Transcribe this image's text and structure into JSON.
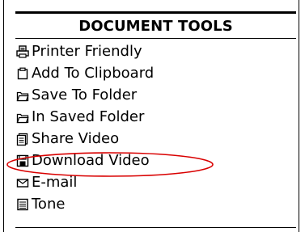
{
  "panel": {
    "title": "DOCUMENT TOOLS",
    "items": [
      {
        "icon": "printer-icon",
        "label": "Printer Friendly"
      },
      {
        "icon": "clipboard-icon",
        "label": "Add To Clipboard"
      },
      {
        "icon": "folder-save-icon",
        "label": "Save To Folder"
      },
      {
        "icon": "folder-open-icon",
        "label": "In Saved Folder"
      },
      {
        "icon": "share-video-icon",
        "label": "Share Video"
      },
      {
        "icon": "floppy-disk-icon",
        "label": "Download Video"
      },
      {
        "icon": "envelope-icon",
        "label": "E-mail"
      },
      {
        "icon": "document-lines-icon",
        "label": "Tone"
      }
    ]
  },
  "annotation": {
    "highlighted_item": "Download Video",
    "highlight_color": "#d90000"
  }
}
